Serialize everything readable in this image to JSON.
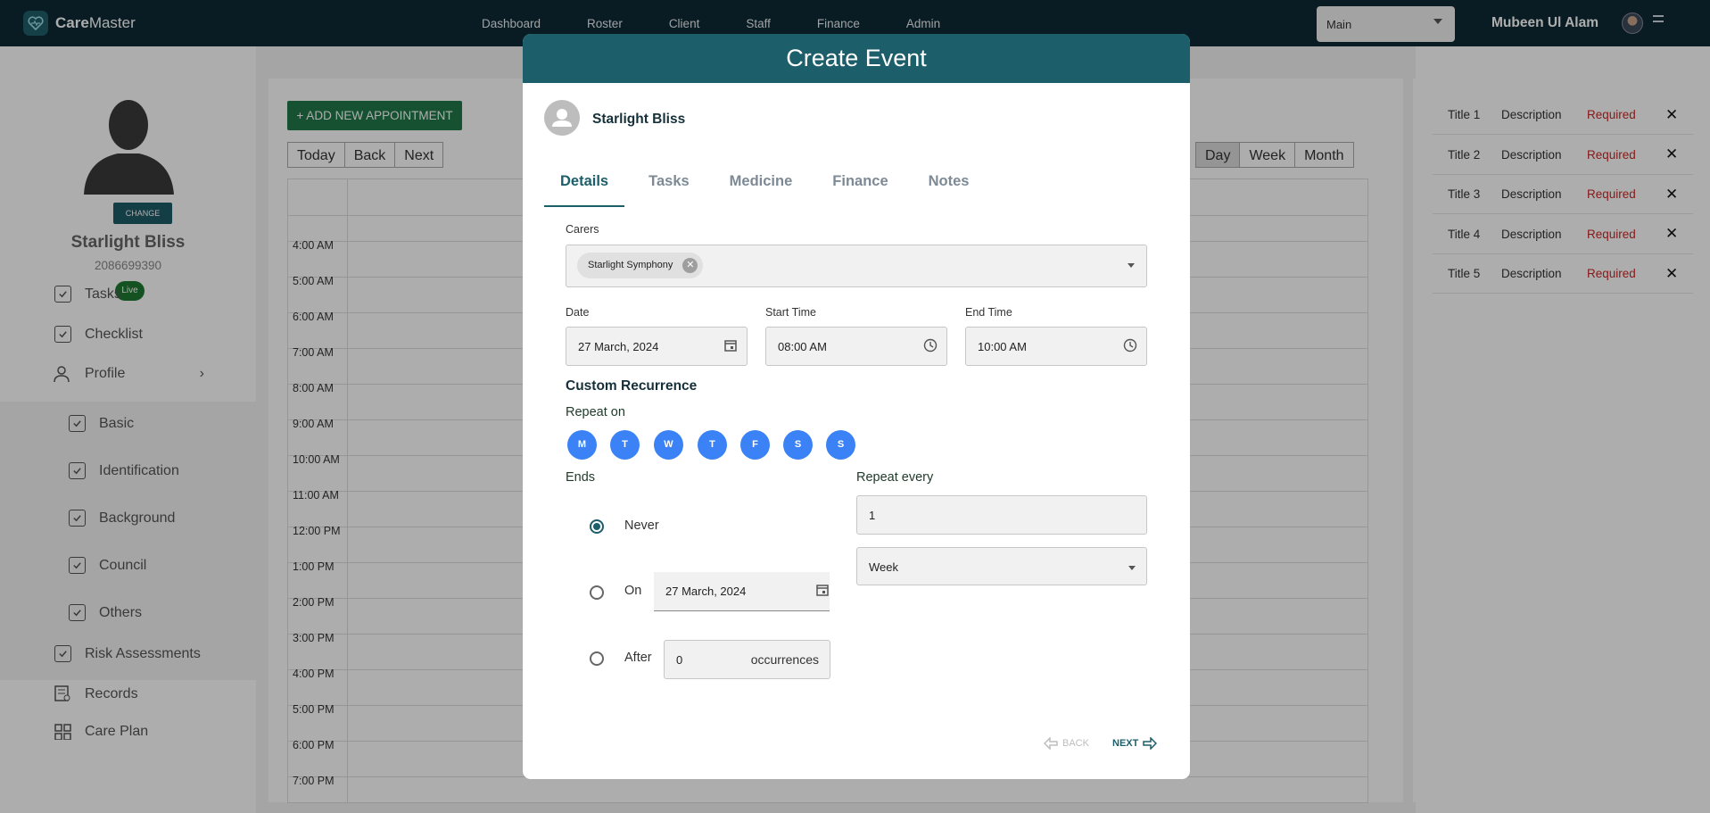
{
  "brand": {
    "name_bold": "Care",
    "name_rest": "Master"
  },
  "nav": {
    "items": [
      "Dashboard",
      "Roster",
      "Client",
      "Staff",
      "Finance",
      "Admin"
    ]
  },
  "branch_select": {
    "value": "Main"
  },
  "user": {
    "name": "Mubeen Ul Alam"
  },
  "patient": {
    "name": "Starlight Bliss",
    "phone": "2086699390",
    "status": "Live",
    "change_label": "CHANGE"
  },
  "sidebar": {
    "items": [
      {
        "label": "Tasks"
      },
      {
        "label": "Checklist"
      },
      {
        "label": "Profile"
      },
      {
        "label": "Basic"
      },
      {
        "label": "Identification"
      },
      {
        "label": "Background"
      },
      {
        "label": "Council"
      },
      {
        "label": "Others"
      },
      {
        "label": "Risk Assessments"
      },
      {
        "label": "Records"
      },
      {
        "label": "Care Plan"
      }
    ]
  },
  "calendar": {
    "add_label": "+ ADD NEW APPOINTMENT",
    "nav_buttons": [
      "Today",
      "Back",
      "Next"
    ],
    "view_buttons": [
      "Day",
      "Week",
      "Month"
    ],
    "active_view": "Day",
    "times": [
      "4:00 AM",
      "5:00 AM",
      "6:00 AM",
      "7:00 AM",
      "8:00 AM",
      "9:00 AM",
      "10:00 AM",
      "11:00 AM",
      "12:00 PM",
      "1:00 PM",
      "2:00 PM",
      "3:00 PM",
      "4:00 PM",
      "5:00 PM",
      "6:00 PM",
      "7:00 PM"
    ]
  },
  "requirements": [
    {
      "title": "Title 1",
      "description": "Description",
      "status": "Required"
    },
    {
      "title": "Title 2",
      "description": "Description",
      "status": "Required"
    },
    {
      "title": "Title 3",
      "description": "Description",
      "status": "Required"
    },
    {
      "title": "Title 4",
      "description": "Description",
      "status": "Required"
    },
    {
      "title": "Title 5",
      "description": "Description",
      "status": "Required"
    }
  ],
  "modal": {
    "title": "Create Event",
    "client_name": "Starlight Bliss",
    "tabs": [
      "Details",
      "Tasks",
      "Medicine",
      "Finance",
      "Notes"
    ],
    "active_tab": "Details",
    "carers_label": "Carers",
    "carer_chip": "Starlight Symphony",
    "date_label": "Date",
    "date_value": "27 March, 2024",
    "start_label": "Start Time",
    "start_value": "08:00 AM",
    "end_label": "End Time",
    "end_value": "10:00 AM",
    "recurrence_title": "Custom Recurrence",
    "repeat_on_label": "Repeat on",
    "days": [
      "M",
      "T",
      "W",
      "T",
      "F",
      "S",
      "S"
    ],
    "ends_label": "Ends",
    "repeat_every_label": "Repeat every",
    "repeat_every_value": "1",
    "repeat_unit": "Week",
    "never_label": "Never",
    "on_label": "On",
    "on_date": "27 March, 2024",
    "after_label": "After",
    "after_value": "0",
    "occurrences_label": "occurrences",
    "ends_selected": "Never",
    "back_label": "BACK",
    "next_label": "NEXT"
  },
  "colors": {
    "navbar": "#0e2a35",
    "primary": "#1c5e69",
    "add_button": "#21784a",
    "day_chip": "#3b82f6",
    "required": "#c62828",
    "live_badge": "#1f7a33"
  }
}
